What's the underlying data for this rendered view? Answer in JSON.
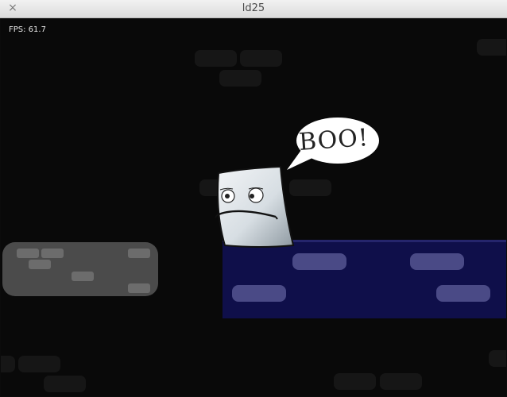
{
  "window": {
    "title": "ld25",
    "close_glyph": "×"
  },
  "hud": {
    "fps": "FPS: 61.7"
  },
  "speech_bubble": {
    "text": "BOO!"
  },
  "colors": {
    "background": "#090909",
    "stone_platform": "#4b4b4b",
    "blue_platform": "#0f0f4a",
    "bubble": "#ffffff"
  }
}
